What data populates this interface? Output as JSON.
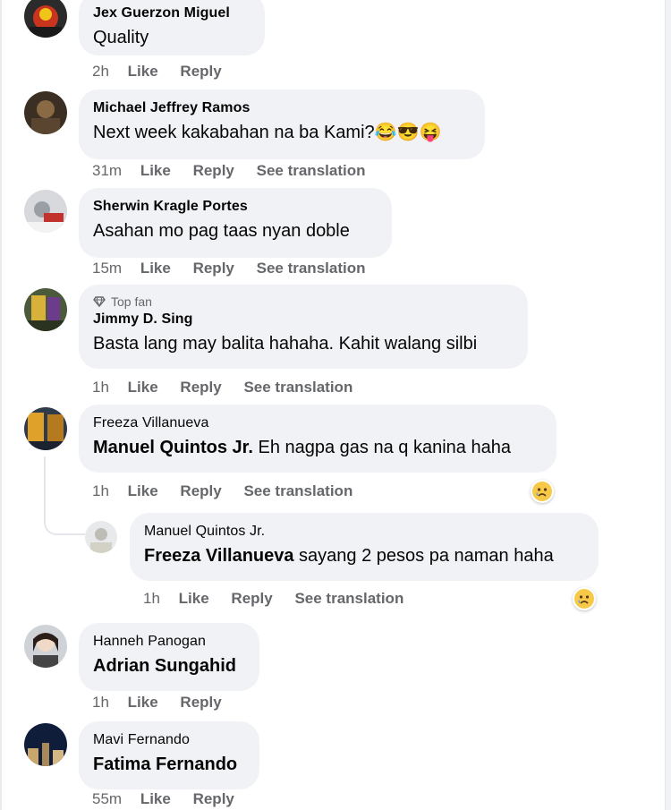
{
  "comments": [
    {
      "author": "Jex Guerzon Miguel",
      "text": "Quality",
      "time": "2h",
      "like": "Like",
      "reply": "Reply"
    },
    {
      "author": "Michael Jeffrey Ramos",
      "text": "Next week kakabahan na ba Kami?",
      "emojis": "😂😎😝",
      "time": "31m",
      "like": "Like",
      "reply": "Reply",
      "translate": "See translation"
    },
    {
      "author": "Sherwin Kragle Portes",
      "text": "Asahan mo pag taas nyan doble",
      "time": "15m",
      "like": "Like",
      "reply": "Reply",
      "translate": "See translation"
    },
    {
      "badge": "Top fan",
      "author": "Jimmy D. Sing",
      "text": "Basta lang may balita hahaha. Kahit walang silbi",
      "time": "1h",
      "like": "Like",
      "reply": "Reply",
      "translate": "See translation"
    },
    {
      "author": "Freeza Villanueva",
      "mention": "Manuel Quintos Jr.",
      "text": " Eh nagpa gas na q kanina haha",
      "time": "1h",
      "like": "Like",
      "reply": "Reply",
      "translate": "See translation",
      "reaction": "sad"
    },
    {
      "author": "Manuel Quintos Jr.",
      "mention": "Freeza Villanueva",
      "text": " sayang 2 pesos pa naman haha",
      "time": "1h",
      "like": "Like",
      "reply": "Reply",
      "translate": "See translation",
      "reaction": "sad"
    },
    {
      "author": "Hanneh Panogan",
      "mention": "Adrian Sungahid",
      "time": "1h",
      "like": "Like",
      "reply": "Reply"
    },
    {
      "author": "Mavi Fernando",
      "mention": "Fatima Fernando",
      "time": "55m",
      "like": "Like",
      "reply": "Reply"
    }
  ],
  "colors": {
    "bubble": "#f0f2f5",
    "meta": "#65676b",
    "text": "#050505"
  }
}
